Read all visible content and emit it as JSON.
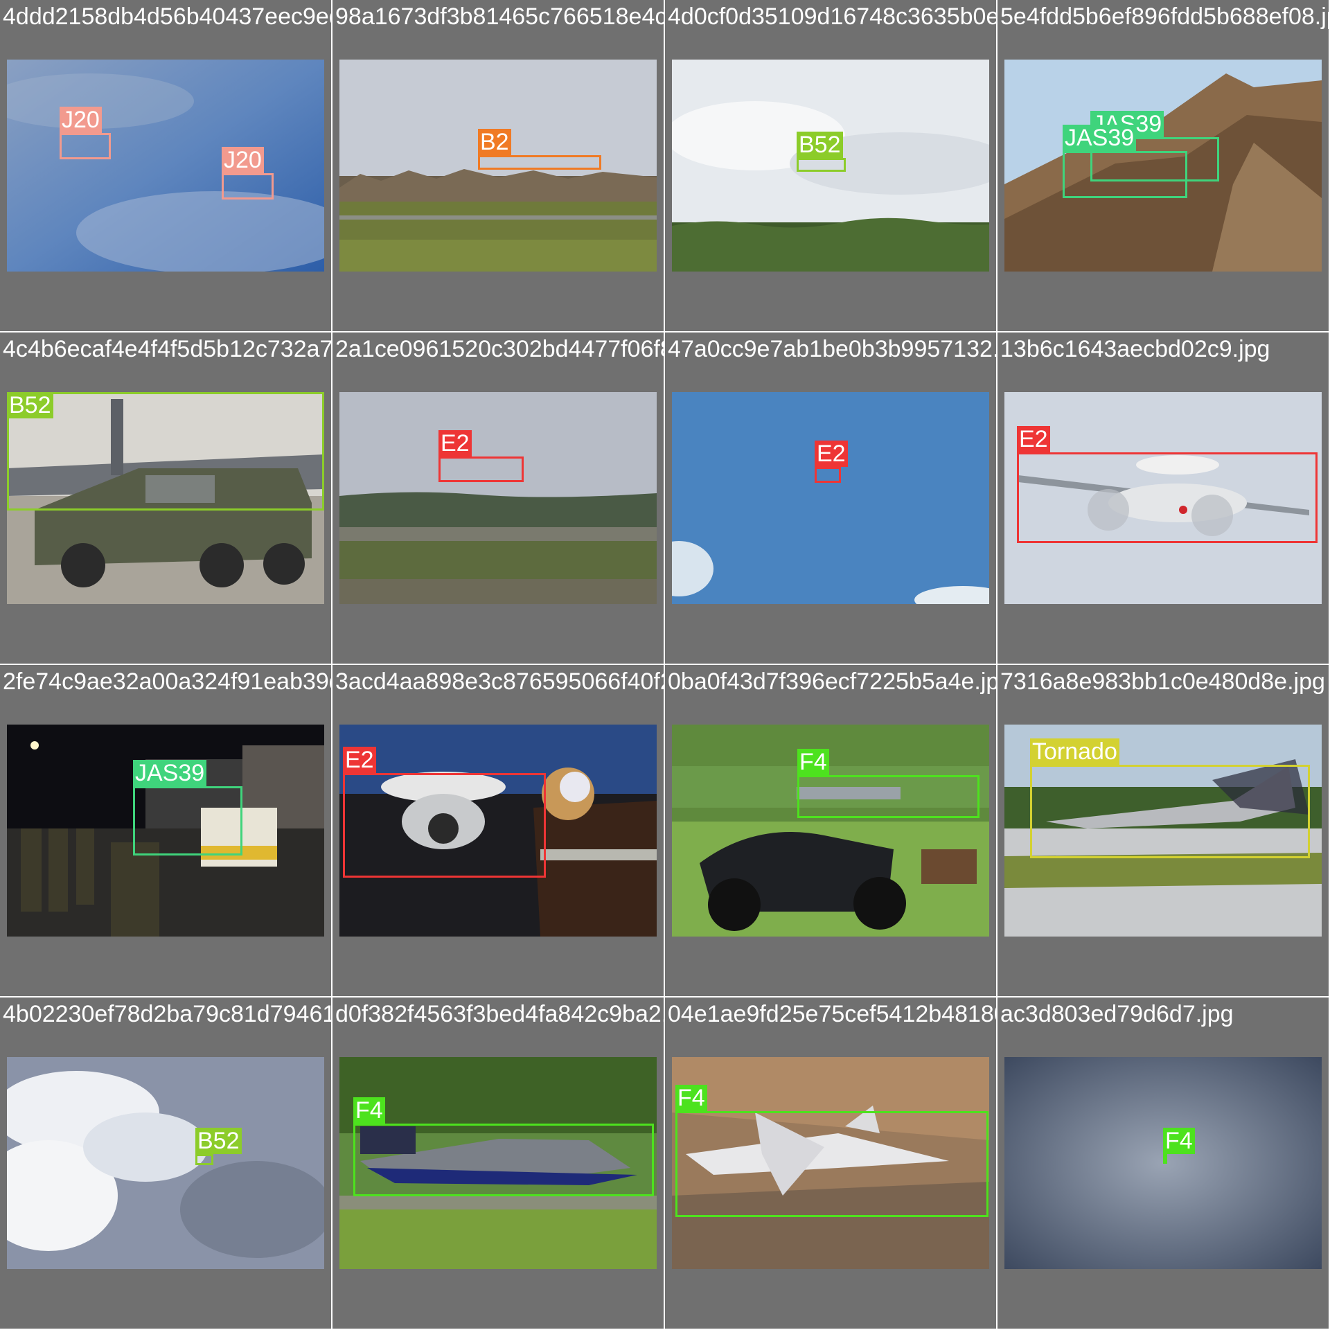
{
  "classes": {
    "J20": "#f29a8e",
    "B2": "#f07a24",
    "B52": "#8ccc2a",
    "JAS39": "#3fd47c",
    "E2": "#ee3535",
    "F4": "#4de21e",
    "Tornado": "#d3d131"
  },
  "tiles": [
    {
      "filename": "4ddd2158db4d56b40437eec9edf92b2f.jpg",
      "scene": "sky-blue-haze",
      "detections": [
        {
          "cls": "J20",
          "label": "J20"
        },
        {
          "cls": "J20",
          "label": "J20"
        }
      ]
    },
    {
      "filename": "98a1673df3b81465c766518e4c.jpg",
      "scene": "airfield-trees",
      "detections": [
        {
          "cls": "B2",
          "label": "B2"
        }
      ]
    },
    {
      "filename": "4d0cf0d35109d16748c3635b0ef6c543.jpg",
      "scene": "cloudy-forest",
      "detections": [
        {
          "cls": "B52",
          "label": "B52"
        }
      ]
    },
    {
      "filename": "5e4fdd5b6ef896fdd5b688ef08.jpg",
      "scene": "mountain",
      "detections": [
        {
          "cls": "JAS39",
          "label": "JAS39"
        },
        {
          "cls": "JAS39",
          "label": "JAS39"
        }
      ]
    },
    {
      "filename": "4c4b6ecaf4e4f4f5d5b12c732a75ef97.jpg",
      "scene": "truck-b52",
      "detections": [
        {
          "cls": "B52",
          "label": "B52"
        }
      ]
    },
    {
      "filename": "2a1ce0961520c302bd4477f06f88b724.jpg",
      "scene": "forest-horizon",
      "detections": [
        {
          "cls": "E2",
          "label": "E2"
        }
      ]
    },
    {
      "filename": "47a0cc9e7ab1be0b3b9957132.jpg",
      "scene": "clear-sky",
      "detections": [
        {
          "cls": "E2",
          "label": "E2"
        }
      ]
    },
    {
      "filename": "13b6c1643aecbd02c9.jpg",
      "scene": "e2-closeup",
      "detections": [
        {
          "cls": "E2",
          "label": "E2"
        }
      ]
    },
    {
      "filename": "2fe74c9ae32a00a324f91eab39d45bdf91.jpg",
      "scene": "night-soldiers",
      "detections": [
        {
          "cls": "JAS39",
          "label": "JAS39"
        }
      ]
    },
    {
      "filename": "3acd4aa898e3c876595066f40f213.jpg",
      "scene": "carrier-deck",
      "detections": [
        {
          "cls": "E2",
          "label": "E2"
        }
      ]
    },
    {
      "filename": "0ba0f43d7f396ecf7225b5a4e.jpg",
      "scene": "park-motorcycle",
      "detections": [
        {
          "cls": "F4",
          "label": "F4"
        }
      ]
    },
    {
      "filename": "7316a8e983bb1c0e480d8e.jpg",
      "scene": "tornado-runway",
      "detections": [
        {
          "cls": "Tornado",
          "label": "Tornado"
        }
      ]
    },
    {
      "filename": "4b02230ef78d2ba79c81d79461472a39e.jpg",
      "scene": "cumulus",
      "detections": [
        {
          "cls": "B52",
          "label": "B52"
        }
      ]
    },
    {
      "filename": "d0f382f4563f3bed4fa842c9ba2.jpg",
      "scene": "f4-nato",
      "detections": [
        {
          "cls": "F4",
          "label": "F4"
        }
      ]
    },
    {
      "filename": "04e1ae9fd25e75cef5412b48180.jpg",
      "scene": "f4-desert",
      "detections": [
        {
          "cls": "F4",
          "label": "F4"
        }
      ]
    },
    {
      "filename": "ac3d803ed79d6d7.jpg",
      "scene": "grey-sky",
      "detections": [
        {
          "cls": "F4",
          "label": "F4"
        }
      ]
    }
  ]
}
